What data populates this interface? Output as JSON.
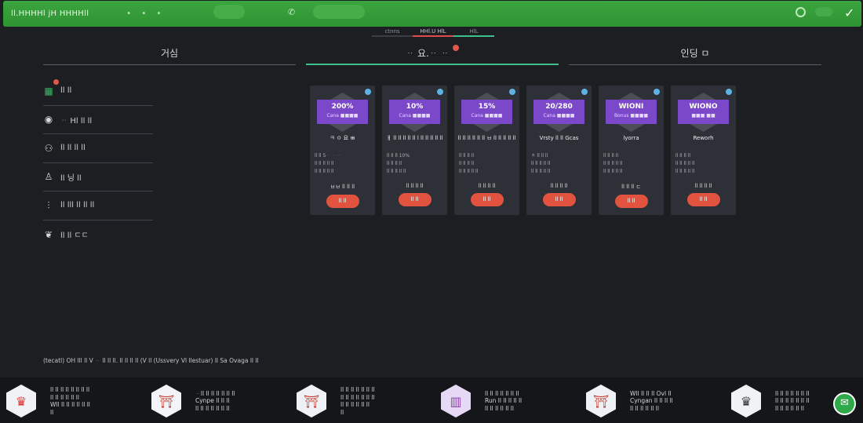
{
  "topbar": {
    "brand": "ll.HHHHl jH HHHHll",
    "dots": "• • •",
    "colors": {
      "background": "#2f9433"
    }
  },
  "subtabs": [
    "ctnns",
    "HHl.U HlL",
    "HlL"
  ],
  "tabs": [
    {
      "label": "거심"
    },
    {
      "label": "ᆢ 요.ᆢ ᆢ",
      "has_notification": true
    },
    {
      "label": "인딩 ㅁ"
    }
  ],
  "sidebar": {
    "items": [
      {
        "icon": "gift-icon",
        "label": "ll ll",
        "has_notification": true
      },
      {
        "icon": "clock-icon",
        "label": "ᆢ Hl ll ll"
      },
      {
        "icon": "users-icon",
        "label": "ll ll ll ll"
      },
      {
        "icon": "person-add-icon",
        "label": "ll 닝 ll"
      },
      {
        "icon": "chart-icon",
        "label": "ll lll ll ll ll"
      },
      {
        "icon": "gamepad-icon",
        "label": "ll ll ㄷㄷ"
      }
    ]
  },
  "cards": [
    {
      "headline": "200%",
      "sub": "Cana ■■■■",
      "title": "ㅋ ㅇ 요 ㅃ",
      "details": [
        "ll ll    5ᆢ ᆢ ᆢ",
        "ll ll ll    ll ll",
        "ll ll ll    ll ll"
      ],
      "foot": "ㅂㅂ ll ll ll",
      "button": "ll ll"
    },
    {
      "headline": "10%",
      "sub": "Cana ■■■■",
      "title": "ㅐ ll ll ll ll ll l ll ll ll ll ll",
      "details": [
        "ll ll ll    10%",
        "ll ll ll    ll",
        "ll ll ll    ll ll"
      ],
      "foot": "ll ll ll ll",
      "button": "ll ll"
    },
    {
      "headline": "15%",
      "sub": "Cana ■■■■",
      "title": "ll ll ll ll ll ll ㅂ ll ll ll ll ll",
      "details": [
        "ll ll ll    ll",
        "ll ll ll    ll",
        "ll ll ll    ll ll"
      ],
      "foot": "ll ll ll ll",
      "button": "ll ll"
    },
    {
      "headline": "20/280",
      "sub": "Cana ■■■■",
      "title": "Vrsty ll ll Gcas",
      "details": [
        "ㅊ ll    ll ll",
        "ll ll ll    ll ll",
        "ll ll ll    ll ll"
      ],
      "foot": "ll ll ll ll",
      "button": "ll ll"
    },
    {
      "headline": "WIONI",
      "sub": "Bonus ■■■■",
      "title": "lyorra",
      "details": [
        "ll ll    ll ll",
        "ll ll ll    ll ll",
        "ll ll ll    ll ll"
      ],
      "foot": "ll ll ll ㄷ",
      "button": "ll ll"
    },
    {
      "headline": "WIONO",
      "sub": "■■■ ■■",
      "title": "Reworh",
      "details": [
        "ll ll    ll ll",
        "ll ll ll    ll ll",
        "ll ll ll    ll ll"
      ],
      "foot": "ll ll ll ll",
      "button": "ll ll"
    }
  ],
  "disclaimer": "(tecatl) OH lll ll V ᆢ ll ll ll. ll ll ll ll (V ll (Ussvery Vl llestuar) ll Sa Ovaga ll ll",
  "providers": [
    {
      "icon": "host-avatar-icon",
      "bg": "#f0f2f5",
      "lines": [
        "ll ll ll ll ll ll ll ll",
        "ll ll ll ll ll ll",
        "Wll ll ll ll ll ll ll",
        "ll"
      ]
    },
    {
      "icon": "temple-icon",
      "bg": "#f2f4f7",
      "lines": [
        "ᆢll ll ll ll ll ll ll",
        "Cynpe ll ll ll",
        "ll ll ll ll ll ll ll"
      ]
    },
    {
      "icon": "temple-icon",
      "bg": "#eef2f6",
      "lines": [
        "ll ll ll ll ll ll ll",
        "ll ll ll ll ll ll ll",
        "ll ll ll ll ll ll",
        "ll"
      ]
    },
    {
      "icon": "slot-machine-icon",
      "bg": "#e6d9f5",
      "lines": [
        "ll ll ll ll ll ll ll",
        "Run ll ll ll ll ll",
        "ll ll ll ll ll ll"
      ]
    },
    {
      "icon": "temple-icon",
      "bg": "#eef2f6",
      "lines": [
        "Wll ll ll ll Ovl ll",
        "Cyngan ll ll ll ll",
        "ll ll ll ll ll ll"
      ]
    },
    {
      "icon": "host-avatar-icon",
      "bg": "#f0f2f5",
      "lines": [
        "ll ll ll ll ll ll ll",
        "ll ll ll ll ll ll ll",
        "ll ll ll ll ll ll"
      ]
    }
  ],
  "chat": {
    "icon": "chat-icon"
  }
}
